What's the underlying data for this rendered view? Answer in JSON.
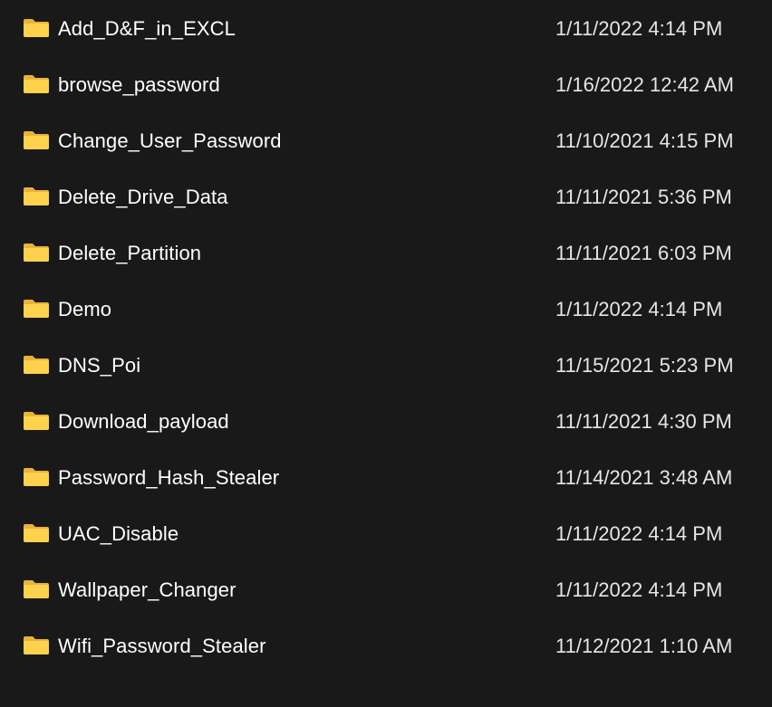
{
  "colors": {
    "background": "#191919",
    "folder_front": "#ffd24d",
    "folder_back": "#e8b33a",
    "name_text": "#ffffff",
    "date_text": "#e6e6e6"
  },
  "files": [
    {
      "name": "Add_D&F_in_EXCL",
      "date_modified": "1/11/2022 4:14 PM",
      "icon": "folder-icon"
    },
    {
      "name": "browse_password",
      "date_modified": "1/16/2022 12:42 AM",
      "icon": "folder-icon"
    },
    {
      "name": "Change_User_Password",
      "date_modified": "11/10/2021 4:15 PM",
      "icon": "folder-icon"
    },
    {
      "name": "Delete_Drive_Data",
      "date_modified": "11/11/2021 5:36 PM",
      "icon": "folder-icon"
    },
    {
      "name": "Delete_Partition",
      "date_modified": "11/11/2021 6:03 PM",
      "icon": "folder-icon"
    },
    {
      "name": "Demo",
      "date_modified": "1/11/2022 4:14 PM",
      "icon": "folder-icon"
    },
    {
      "name": "DNS_Poi",
      "date_modified": "11/15/2021 5:23 PM",
      "icon": "folder-icon"
    },
    {
      "name": "Download_payload",
      "date_modified": "11/11/2021 4:30 PM",
      "icon": "folder-icon"
    },
    {
      "name": "Password_Hash_Stealer",
      "date_modified": "11/14/2021 3:48 AM",
      "icon": "folder-icon"
    },
    {
      "name": "UAC_Disable",
      "date_modified": "1/11/2022 4:14 PM",
      "icon": "folder-icon"
    },
    {
      "name": "Wallpaper_Changer",
      "date_modified": "1/11/2022 4:14 PM",
      "icon": "folder-icon"
    },
    {
      "name": "Wifi_Password_Stealer",
      "date_modified": "11/12/2021 1:10 AM",
      "icon": "folder-icon"
    }
  ]
}
